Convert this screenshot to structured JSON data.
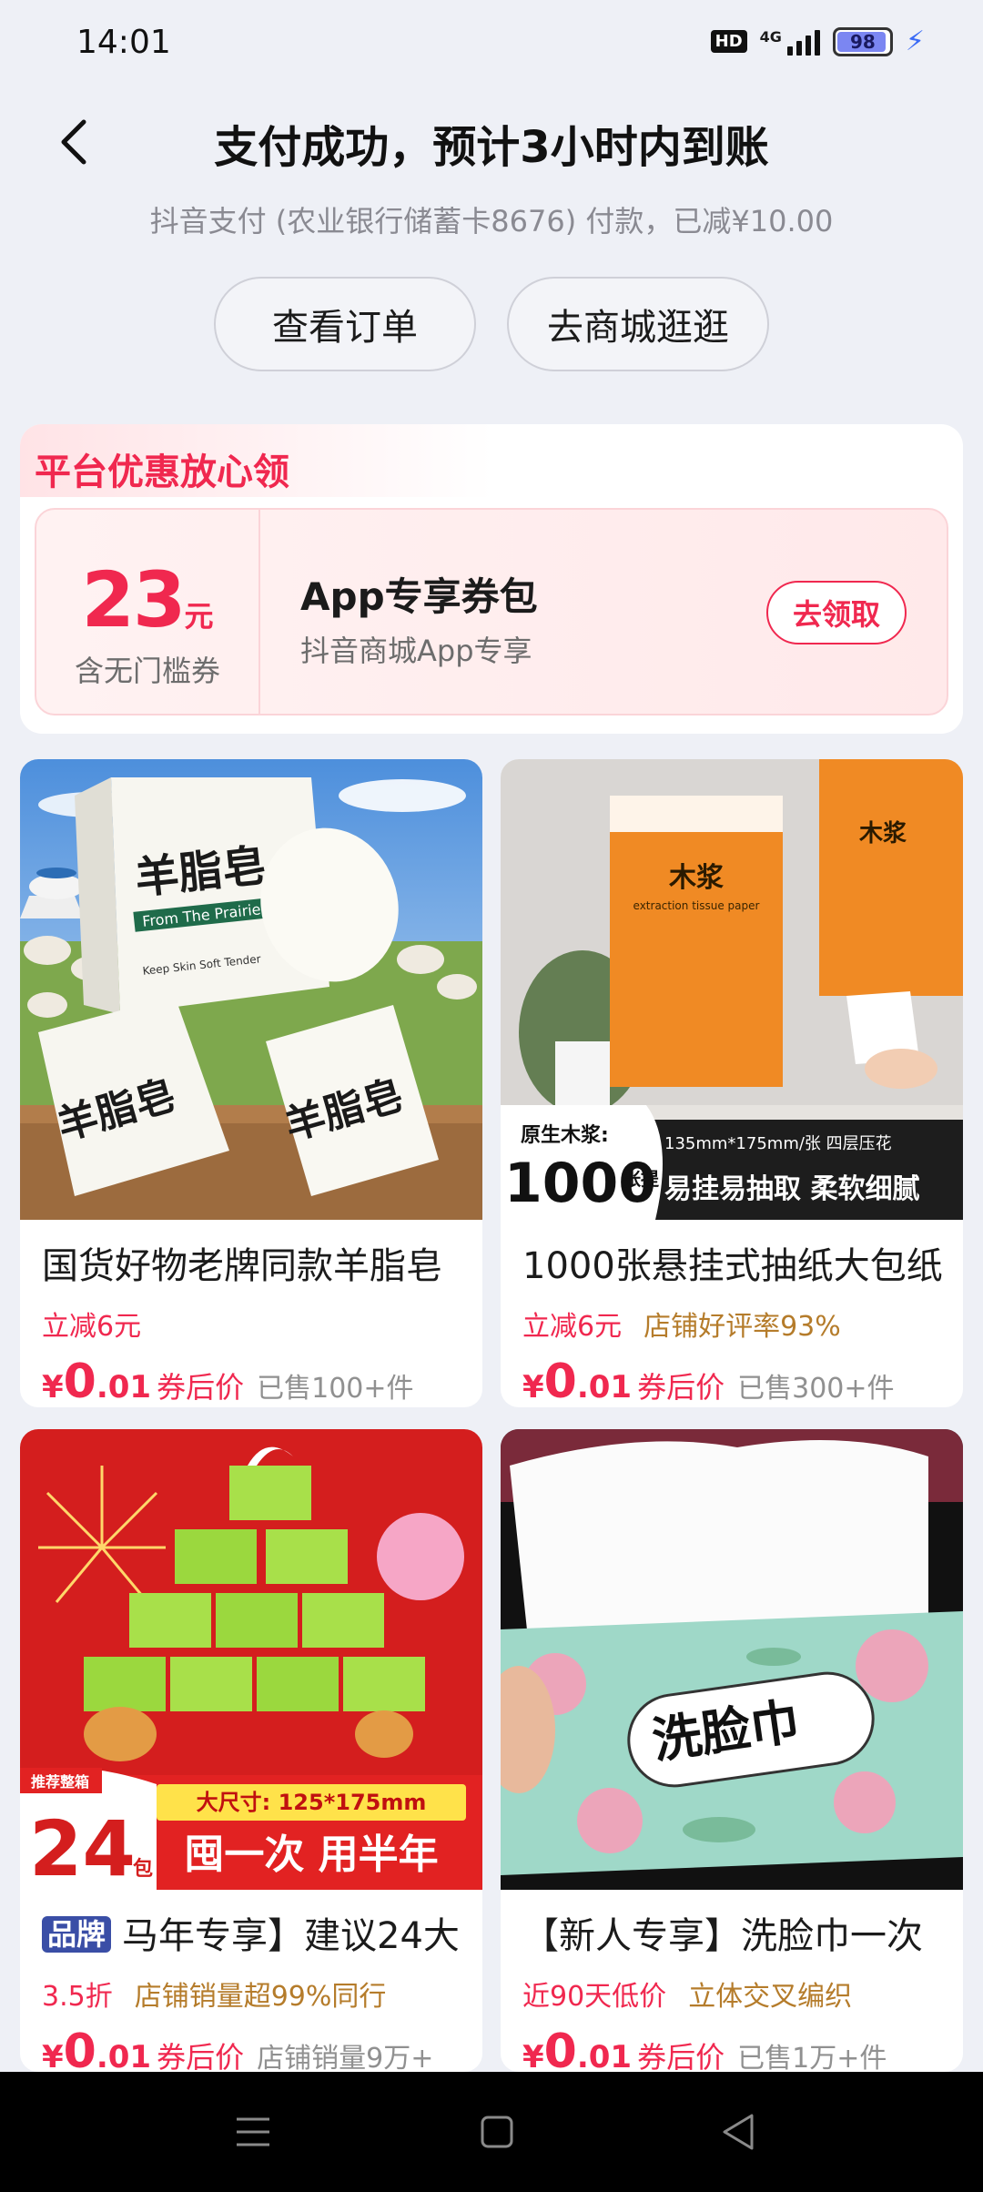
{
  "status_bar": {
    "time": "14:01",
    "hd_label": "HD",
    "network_label": "4G",
    "battery_level": "98",
    "battery_percent": 98
  },
  "header": {
    "title": "支付成功，预计3小时内到账",
    "subtitle": "抖音支付 (农业银行储蓄卡8676) 付款，已减¥10.00"
  },
  "actions": {
    "view_order": "查看订单",
    "go_shopping": "去商城逛逛"
  },
  "coupon": {
    "heading": "平台优惠放心领",
    "amount": "23",
    "unit": "元",
    "amount_desc": "含无门槛券",
    "title": "App专享券包",
    "subtitle": "抖音商城App专享",
    "claim_label": "去领取"
  },
  "products": [
    {
      "title": "国货好物老牌同款羊脂皂",
      "tags": [
        "立减6元"
      ],
      "price_symbol": "¥",
      "price_int": "0",
      "price_dec": ".01",
      "price_label": "券后价",
      "sold": "已售100+件",
      "image": {
        "badge_main": "羊脂皂",
        "badge_sub": "From The Prairie",
        "small_text": "Keep Skin Soft Tender"
      }
    },
    {
      "title": "1000张悬挂式抽纸大包纸",
      "tags": [
        "立减6元",
        "店铺好评率93%"
      ],
      "price_symbol": "¥",
      "price_int": "0",
      "price_dec": ".01",
      "price_label": "券后价",
      "sold": "已售300+件",
      "image": {
        "label_top": "原生木浆:",
        "count": "1000",
        "unit": "张提",
        "spec": "135mm*175mm/张 四层压花",
        "slogan": "易挂易抽取 柔软细腻",
        "pack_text": "木浆",
        "pack_sub": "extraction tissue paper"
      }
    },
    {
      "title": "马年专享】建议24大",
      "brand_tag": "品牌",
      "tags": [
        "3.5折",
        "店铺销量超99%同行"
      ],
      "price_symbol": "¥",
      "price_int": "0",
      "price_dec": ".01",
      "price_label": "券后价",
      "sold": "店铺销量9万+",
      "image": {
        "ribbon": "推荐整箱",
        "count": "24",
        "unit": "包",
        "size": "大尺寸: 125*175mm",
        "slogan": "囤一次 用半年"
      }
    },
    {
      "title": "【新人专享】洗脸巾一次",
      "tags": [
        "近90天低价",
        "立体交叉编织"
      ],
      "price_symbol": "¥",
      "price_int": "0",
      "price_dec": ".01",
      "price_label": "券后价",
      "sold": "已售1万+件",
      "image": {
        "label": "洗脸巾"
      }
    }
  ],
  "colors": {
    "accent": "#f0284f",
    "brand_tag": "#3a4ea6",
    "tag_brown": "#b57c2b",
    "background": "#eef0f6"
  },
  "nav": {
    "icons": [
      "menu-icon",
      "home-icon",
      "back-triangle-icon"
    ]
  }
}
